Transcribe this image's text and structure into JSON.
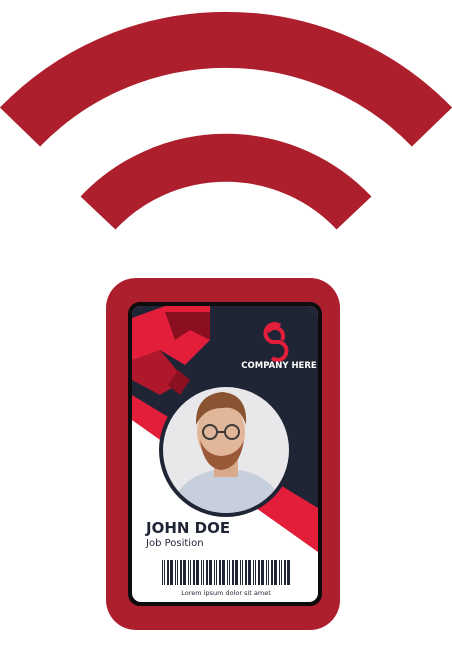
{
  "colors": {
    "brand_red": "#ad1f2d",
    "accent_red": "#e31e3a",
    "card_dark": "#1f2535",
    "text_dark": "#1f2535"
  },
  "icons": [
    "wireless-signal-icon",
    "company-logo-icon"
  ],
  "card": {
    "company": "COMPANY HERE",
    "name": "JOHN DOE",
    "position": "Job Position",
    "barcode_caption": "Lorem ipsum dolor sit amet"
  }
}
